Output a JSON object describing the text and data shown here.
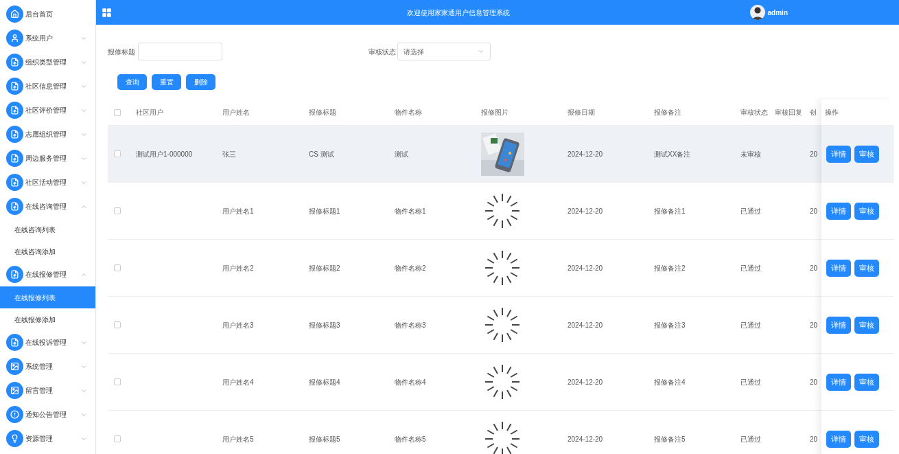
{
  "header": {
    "title": "欢迎使用家家通用户信息管理系统",
    "user": "admin"
  },
  "sidebar": {
    "items": [
      {
        "label": "后台首页",
        "kind": "link"
      },
      {
        "label": "系统用户",
        "kind": "menu",
        "expanded": false
      },
      {
        "label": "组织类型管理",
        "kind": "menu",
        "expanded": false
      },
      {
        "label": "社区信息管理",
        "kind": "menu",
        "expanded": false
      },
      {
        "label": "社区评价管理",
        "kind": "menu",
        "expanded": false
      },
      {
        "label": "志愿组织管理",
        "kind": "menu",
        "expanded": false
      },
      {
        "label": "周边服务管理",
        "kind": "menu",
        "expanded": false
      },
      {
        "label": "社区活动管理",
        "kind": "menu",
        "expanded": false
      },
      {
        "label": "在线咨询管理",
        "kind": "menu",
        "expanded": true,
        "children": [
          {
            "label": "在线咨询列表",
            "selected": false
          },
          {
            "label": "在线咨询添加",
            "selected": false
          }
        ]
      },
      {
        "label": "在线报修管理",
        "kind": "menu",
        "expanded": true,
        "children": [
          {
            "label": "在线报修列表",
            "selected": true
          },
          {
            "label": "在线报修添加",
            "selected": false
          }
        ]
      },
      {
        "label": "在线投诉管理",
        "kind": "menu",
        "expanded": false
      },
      {
        "label": "系统管理",
        "kind": "menu",
        "expanded": false
      },
      {
        "label": "留言管理",
        "kind": "menu",
        "expanded": false
      },
      {
        "label": "通知公告管理",
        "kind": "menu",
        "expanded": false
      },
      {
        "label": "资源管理",
        "kind": "menu",
        "expanded": false
      }
    ]
  },
  "filters": {
    "title_label": "报修标题",
    "status_label": "审核状态",
    "status_placeholder": "请选择"
  },
  "actions": [
    "查询",
    "重置",
    "删除"
  ],
  "table": {
    "all_checked": false,
    "columns": [
      "社区用户",
      "用户姓名",
      "报修标题",
      "物件名称",
      "报修图片",
      "报修日期",
      "报修备注",
      "审核状态",
      "审核回复",
      "创"
    ],
    "action_column": "操作",
    "rows": [
      {
        "hovered": true,
        "checked": false,
        "kind": "picture",
        "cells": [
          "测试用户1-000000",
          "张三",
          "CS 测试",
          "测试"
        ],
        "date": "2024-12-20",
        "note": "测试XX备注",
        "status": "未审核",
        "created": "20",
        "buttons": [
          "详情",
          "审核"
        ]
      },
      {
        "hovered": false,
        "checked": false,
        "kind": "loading",
        "cells": [
          "",
          "用户姓名1",
          "报修标题1",
          "物件名称1"
        ],
        "date": "2024-12-20",
        "note": "报修备注1",
        "status": "已通过",
        "created": "20",
        "buttons": [
          "详情",
          "审核"
        ]
      },
      {
        "hovered": false,
        "checked": false,
        "kind": "loading",
        "cells": [
          "",
          "用户姓名2",
          "报修标题2",
          "物件名称2"
        ],
        "date": "2024-12-20",
        "note": "报修备注2",
        "status": "已通过",
        "created": "20",
        "buttons": [
          "详情",
          "审核"
        ]
      },
      {
        "hovered": false,
        "checked": false,
        "kind": "loading",
        "cells": [
          "",
          "用户姓名3",
          "报修标题3",
          "物件名称3"
        ],
        "date": "2024-12-20",
        "note": "报修备注3",
        "status": "已通过",
        "created": "20",
        "buttons": [
          "详情",
          "审核"
        ]
      },
      {
        "hovered": false,
        "checked": false,
        "kind": "loading",
        "cells": [
          "",
          "用户姓名4",
          "报修标题4",
          "物件名称4"
        ],
        "date": "2024-12-20",
        "note": "报修备注4",
        "status": "已通过",
        "created": "20",
        "buttons": [
          "详情",
          "审核"
        ]
      },
      {
        "hovered": false,
        "checked": false,
        "kind": "loading",
        "cells": [
          "",
          "用户姓名5",
          "报修标题5",
          "物件名称5"
        ],
        "date": "2024-12-20",
        "note": "报修备注5",
        "status": "已通过",
        "created": "20",
        "buttons": [
          "详情",
          "审核"
        ]
      }
    ]
  }
}
